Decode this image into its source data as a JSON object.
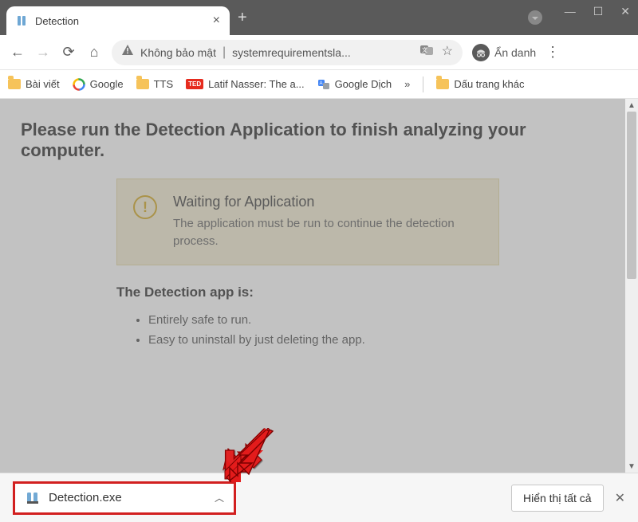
{
  "tab": {
    "title": "Detection"
  },
  "omnibox": {
    "security_text": "Không bảo mật",
    "url": "systemrequirementsla..."
  },
  "incognito": {
    "label": "Ẩn danh"
  },
  "bookmarks": {
    "items": [
      {
        "label": "Bài viết"
      },
      {
        "label": "Google"
      },
      {
        "label": "TTS"
      },
      {
        "label": "Latif Nasser: The a..."
      },
      {
        "label": "Google Dịch"
      }
    ],
    "other": "Dấu trang khác"
  },
  "page": {
    "heading": "Please run the Detection Application to finish analyzing your computer.",
    "notice_title": "Waiting for Application",
    "notice_body": "The application must be run to continue the detection process.",
    "section_heading": "The Detection app is:",
    "bullets": [
      "Entirely safe to run.",
      "Easy to uninstall by just deleting the app."
    ]
  },
  "download": {
    "file": "Detection.exe",
    "show_all": "Hiển thị tất cả"
  }
}
